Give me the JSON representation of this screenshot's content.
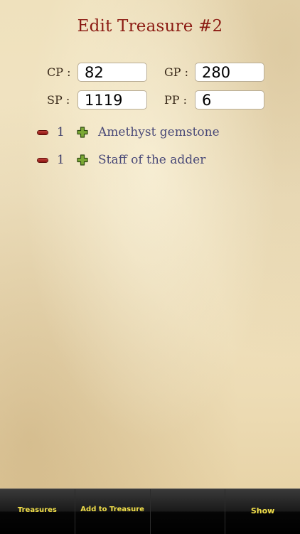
{
  "header": {
    "title": "Edit Treasure #2"
  },
  "coins": {
    "cp": {
      "label": "CP :",
      "value": "82"
    },
    "gp": {
      "label": "GP :",
      "value": "280"
    },
    "sp": {
      "label": "SP :",
      "value": "1119"
    },
    "pp": {
      "label": "PP :",
      "value": "6"
    }
  },
  "items": [
    {
      "qty": "1",
      "name": "Amethyst gemstone"
    },
    {
      "qty": "1",
      "name": "Staff of the adder"
    }
  ],
  "tabbar": {
    "tabs": [
      {
        "label": "Treasures"
      },
      {
        "label": "Add to Treasure"
      },
      {
        "label": ""
      },
      {
        "label": "Show"
      }
    ]
  },
  "colors": {
    "title": "#8b1a12",
    "parchment": "#f1e4c3",
    "tab_text": "#f2e04a",
    "minus": "#a8241e",
    "plus": "#6f9a2e"
  },
  "icons": {
    "decrement": "minus-icon",
    "increment": "plus-icon"
  }
}
